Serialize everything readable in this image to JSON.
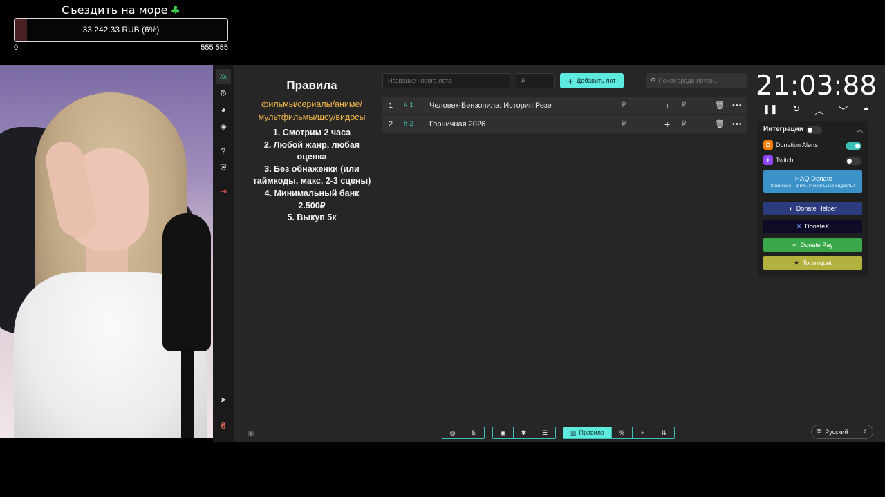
{
  "goal": {
    "title": "Съездить на море",
    "amount_text": "33 242.33 RUB (6%)",
    "progress_fraction": 0.06,
    "scale_min": "0",
    "scale_max": "555 555"
  },
  "rules": {
    "title": "Правила",
    "genres": "фильмы/сериалы/аниме/ мультфильмы/шоу/видосы",
    "items": [
      "1. Смотрим 2 часа",
      "2. Любой жанр, любая оценка",
      "3. Без обнаженки (или таймкоды, макс. 2-3 сцены)",
      "4. Минимальный банк 2.500₽",
      "5. Выкуп 5к"
    ]
  },
  "controls": {
    "lot_name_placeholder": "Название нового лота",
    "price_placeholder": "₽",
    "add_lot_label": "Добавить лот",
    "search_placeholder": "Поиск среди лотов..."
  },
  "lots": [
    {
      "num": "1",
      "hash": "# 1",
      "title": "Человек-Бензопила: История Резе",
      "price": "₽",
      "add_price": "₽"
    },
    {
      "num": "2",
      "hash": "# 2",
      "title": "Горничная 2026",
      "price": "₽",
      "add_price": "₽"
    }
  ],
  "timer": {
    "value": "21:03:88"
  },
  "integrations": {
    "title": "Интеграции",
    "enabled": false,
    "rows": [
      {
        "name": "Donation Alerts",
        "enabled": true,
        "color": "#f57d07"
      },
      {
        "name": "Twitch",
        "enabled": false,
        "color": "#9146ff"
      }
    ],
    "buttons": [
      {
        "name": "IHAQ Donate",
        "sub": "Комиссия – 3,5%. Уникальные виджеты!",
        "color": "#3b92c9"
      },
      {
        "name": "Donate Helper",
        "color": "#2c3b7d"
      },
      {
        "name": "DonateX",
        "color": "#0e0b26"
      },
      {
        "name": "Donate Pay",
        "color": "#3aa84a"
      },
      {
        "name": "Tourniquet",
        "color": "#b3b23e"
      }
    ]
  },
  "toolbar": {
    "rules_label": "Правила"
  },
  "language": {
    "selected": "Русский"
  },
  "colors": {
    "accent": "#5eeadf",
    "panel_bg": "#262626",
    "goal_fill": "#4a1f24"
  }
}
